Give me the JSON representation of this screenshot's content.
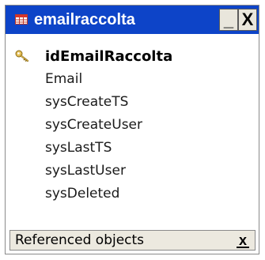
{
  "window": {
    "title": "emailraccolta",
    "minimize_glyph": "_",
    "close_glyph": "X",
    "title_icon": "table-icon",
    "title_bar_color": "#0d44c8"
  },
  "fields": {
    "primary_key": {
      "name": "idEmailRaccolta",
      "icon": "key-icon"
    },
    "items": [
      {
        "name": "Email"
      },
      {
        "name": "sysCreateTS"
      },
      {
        "name": "sysCreateUser"
      },
      {
        "name": "sysLastTS"
      },
      {
        "name": "sysLastUser"
      },
      {
        "name": "sysDeleted"
      }
    ]
  },
  "referenced_objects": {
    "label": "Referenced objects",
    "close_glyph": "x"
  }
}
